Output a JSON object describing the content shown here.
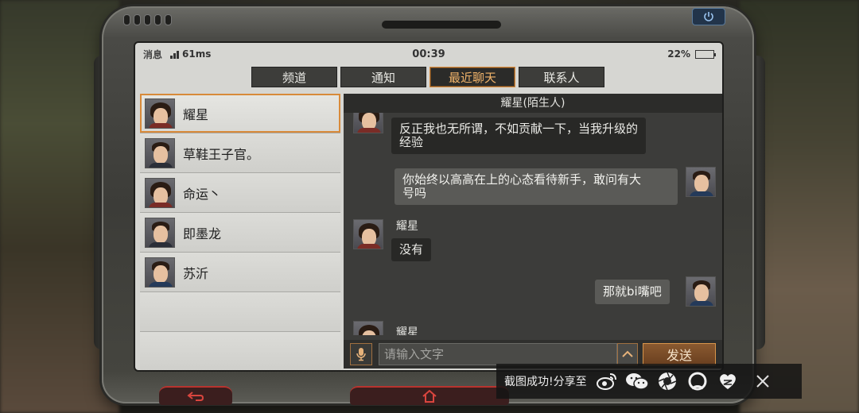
{
  "status_bar": {
    "message_label": "消息",
    "ping": "61ms",
    "time": "00:39",
    "battery_percent": "22%",
    "battery_level": 0.22
  },
  "tabs": [
    {
      "label": "频道",
      "active": false
    },
    {
      "label": "通知",
      "active": false
    },
    {
      "label": "最近聊天",
      "active": true
    },
    {
      "label": "联系人",
      "active": false
    }
  ],
  "contacts": [
    {
      "name": "耀星",
      "selected": true
    },
    {
      "name": "草鞋王子官。",
      "selected": false
    },
    {
      "name": "命运丶",
      "selected": false
    },
    {
      "name": "即墨龙",
      "selected": false
    },
    {
      "name": "苏沂",
      "selected": false
    }
  ],
  "chat": {
    "title": "耀星(陌生人)",
    "messages": [
      {
        "from": "other",
        "text_line1": "反正我也无所谓，不如贡献一下，当我升级的",
        "text_line2": "经验"
      },
      {
        "from": "me",
        "text_line1": "你始终以高高在上的心态看待新手，敢问有大",
        "text_line2": "号吗"
      },
      {
        "from": "other",
        "sender": "耀星",
        "text": "没有"
      },
      {
        "from": "me",
        "text": "那就bi嘴吧"
      },
      {
        "from": "other",
        "sender": "耀星"
      }
    ]
  },
  "input": {
    "placeholder": "请输入文字",
    "send_label": "发送"
  },
  "share_bar": {
    "label": "截图成功!分享至",
    "icons": [
      "weibo-icon",
      "wechat-icon",
      "moments-icon",
      "qq-icon",
      "qzone-icon"
    ]
  },
  "colors": {
    "accent": "#d88a3a",
    "active_tab_text": "#f0b36a",
    "bubble_other": "#282826",
    "bubble_mine": "#5a5a57"
  }
}
